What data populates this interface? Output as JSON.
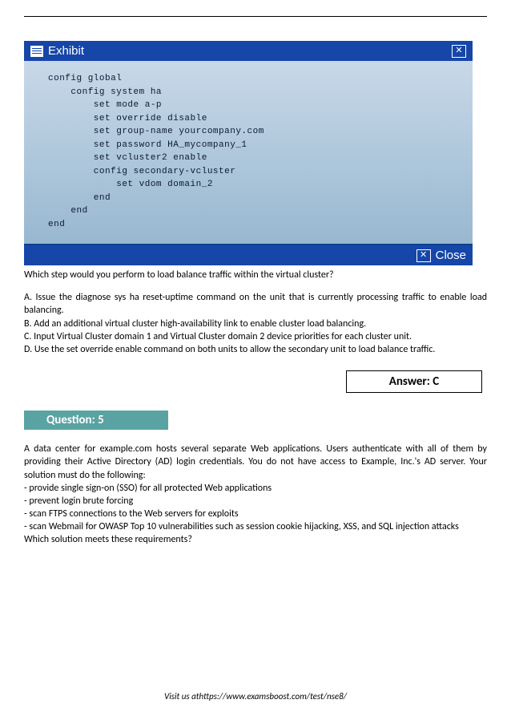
{
  "exhibit": {
    "title": "Exhibit",
    "close_label": "Close",
    "code": "config global\n    config system ha\n        set mode a-p\n        set override disable\n        set group-name yourcompany.com\n        set password HA_mycompany_1\n        set vcluster2 enable\n        config secondary-vcluster\n            set vdom domain_2\n        end\n    end\nend"
  },
  "q4": {
    "stem": "Which step would you perform to load balance traffic within the virtual cluster?",
    "optA": "A. Issue the diagnose sys ha reset-uptime command on the unit that is currently processing traffic to enable load balancing.",
    "optB": "B. Add an additional virtual cluster high-availability link to enable cluster load balancing.",
    "optC": "C. Input Virtual Cluster domain 1 and Virtual Cluster domain 2 device priorities for each cluster unit.",
    "optD": "D. Use the set override enable command on both units to allow the secondary unit to load balance traffic.",
    "answer": "Answer: C"
  },
  "q5": {
    "label": "Question: 5",
    "intro": "A data center for example.com hosts several separate Web applications. Users authenticate with all of them by providing their Active Directory (AD) login credentials. You do not have access to Example, Inc.'s AD server. Your solution must do the following:",
    "req1": "- provide single sign-on (SSO) for all protected Web applications",
    "req2": "- prevent login brute forcing",
    "req3": "- scan FTPS connections to the Web servers for exploits",
    "req4": "- scan Webmail for OWASP Top 10 vulnerabilities such as session cookie hijacking, XSS, and SQL injection attacks",
    "final": "Which solution meets these requirements?"
  },
  "footer": {
    "text": "Visit us athttps://www.examsboost.com/test/nse8/"
  }
}
